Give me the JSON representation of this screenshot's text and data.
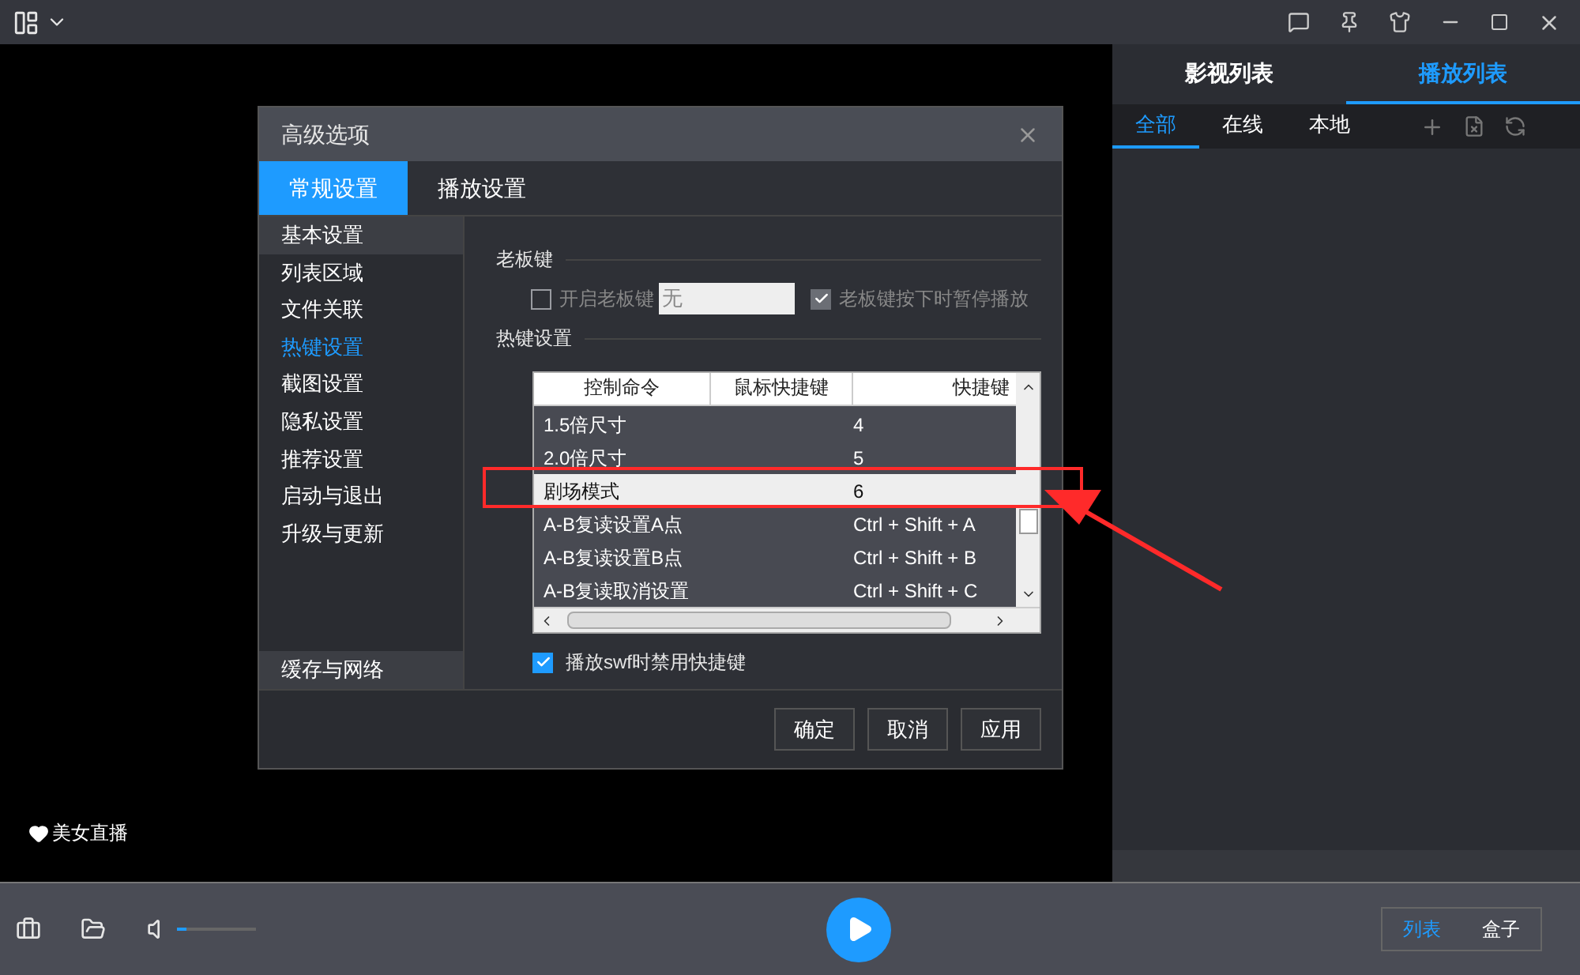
{
  "side_panel": {
    "tabs": [
      {
        "label": "影视列表",
        "selected": false
      },
      {
        "label": "播放列表",
        "selected": true
      }
    ],
    "subtabs": [
      {
        "label": "全部",
        "selected": true
      },
      {
        "label": "在线",
        "selected": false
      },
      {
        "label": "本地",
        "selected": false
      }
    ]
  },
  "live_badge": "美女直播",
  "dialog": {
    "title": "高级选项",
    "tabs": [
      {
        "label": "常规设置",
        "selected": true
      },
      {
        "label": "播放设置",
        "selected": false
      }
    ],
    "nav": [
      {
        "label": "基本设置",
        "selected": false,
        "hover": true
      },
      {
        "label": "列表区域",
        "selected": false,
        "hover": false
      },
      {
        "label": "文件关联",
        "selected": false,
        "hover": false
      },
      {
        "label": "热键设置",
        "selected": true,
        "hover": false
      },
      {
        "label": "截图设置",
        "selected": false,
        "hover": false
      },
      {
        "label": "隐私设置",
        "selected": false,
        "hover": false
      },
      {
        "label": "推荐设置",
        "selected": false,
        "hover": false
      },
      {
        "label": "启动与退出",
        "selected": false,
        "hover": false
      },
      {
        "label": "升级与更新",
        "selected": false,
        "hover": false
      }
    ],
    "nav_bottom": "缓存与网络",
    "boss_key": {
      "heading": "老板键",
      "enable_label": "开启老板键",
      "enabled": false,
      "key_value": "无",
      "pause_label": "老板键按下时暂停播放",
      "pause": true
    },
    "hotkeys": {
      "heading": "热键设置",
      "columns": [
        "控制命令",
        "鼠标快捷键",
        "快捷键"
      ],
      "rows": [
        {
          "command": "1.5倍尺寸",
          "key": "4",
          "selected": false
        },
        {
          "command": "2.0倍尺寸",
          "key": "5",
          "selected": false
        },
        {
          "command": "剧场模式",
          "key": "6",
          "selected": true
        },
        {
          "command": "A-B复读设置A点",
          "key": "Ctrl + Shift + A",
          "selected": false
        },
        {
          "command": "A-B复读设置B点",
          "key": "Ctrl + Shift + B",
          "selected": false
        },
        {
          "command": "A-B复读取消设置",
          "key": "Ctrl + Shift + C",
          "selected": false
        }
      ]
    },
    "swf_label": "播放swf时禁用快捷键",
    "swf_checked": true,
    "buttons": [
      "确定",
      "取消",
      "应用"
    ]
  },
  "controls": {
    "volume": {
      "level": 0.12
    },
    "view_buttons": [
      {
        "label": "列表",
        "selected": true
      },
      {
        "label": "盒子",
        "selected": false
      }
    ]
  }
}
